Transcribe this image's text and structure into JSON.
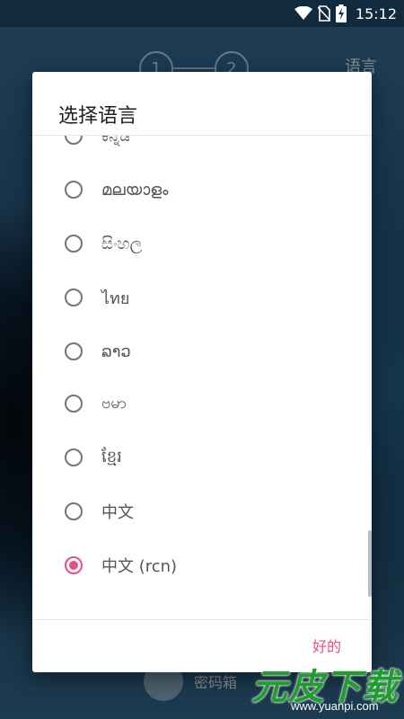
{
  "status_bar": {
    "time": "15:12",
    "icons": [
      "wifi-icon",
      "no-sim-icon",
      "battery-charging-icon"
    ]
  },
  "background": {
    "steps": [
      "1",
      "2"
    ],
    "header_text": "语言",
    "bottom_text": "密码箱"
  },
  "dialog": {
    "title": "选择语言",
    "options": [
      {
        "label": "ಕನ್ನಡ",
        "selected": false
      },
      {
        "label": "മലയാളം",
        "selected": false
      },
      {
        "label": "සිංහල",
        "selected": false
      },
      {
        "label": "ไทย",
        "selected": false
      },
      {
        "label": "ລາວ",
        "selected": false
      },
      {
        "label": "ဗမာ",
        "selected": false
      },
      {
        "label": "ខ្មែរ",
        "selected": false
      },
      {
        "label": "中文",
        "selected": false
      },
      {
        "label": "中文 (rcn)",
        "selected": true
      }
    ],
    "ok_label": "好的",
    "accent_color": "#e74e86"
  },
  "watermark": {
    "text": "元皮下载",
    "url": "www.yuanpi.com"
  }
}
